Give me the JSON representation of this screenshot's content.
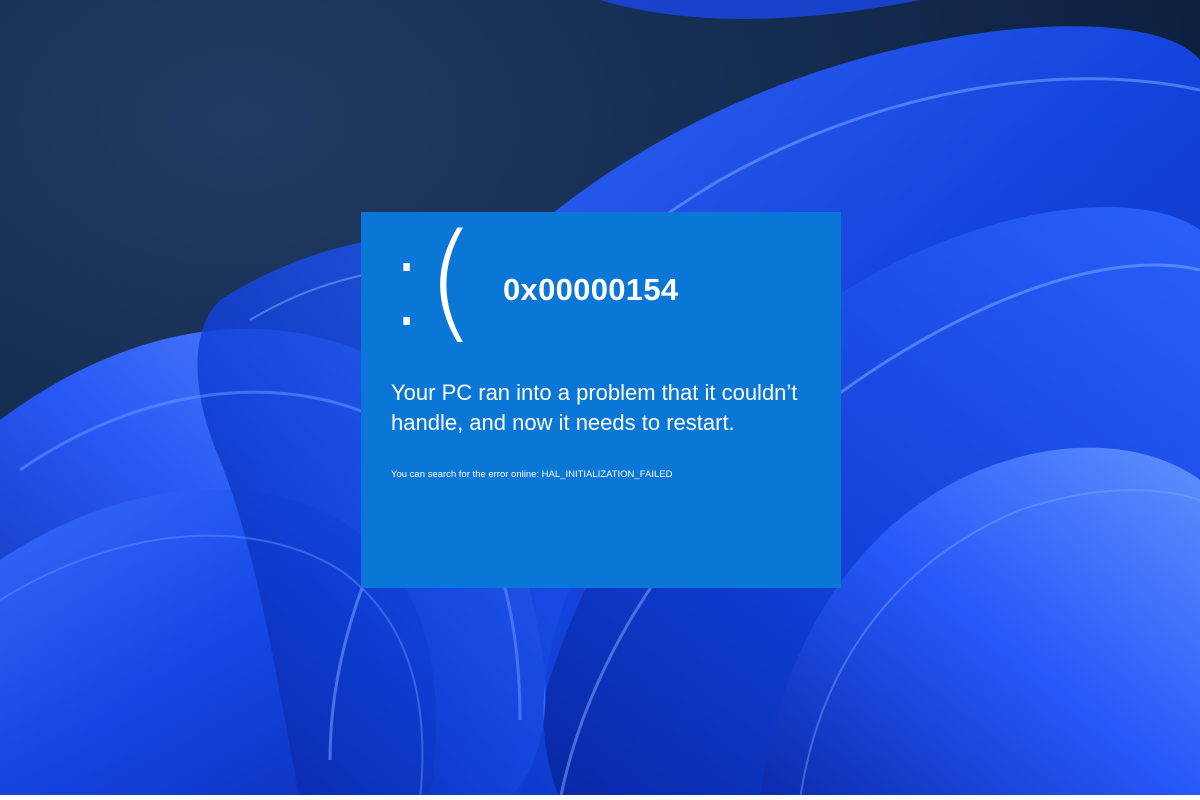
{
  "bsod": {
    "sad_face": ":(",
    "stop_code": "0x00000154",
    "message": "Your PC ran into a problem that it couldn’t handle, and now it needs to restart.",
    "search_hint": "You can search for the error online: HAL_INITIALIZATION_FAILED"
  },
  "colors": {
    "bsod_background": "#0a76d6",
    "text": "#ffffff",
    "wallpaper_dark": "#10203a",
    "wallpaper_blue": "#1f4cff"
  }
}
